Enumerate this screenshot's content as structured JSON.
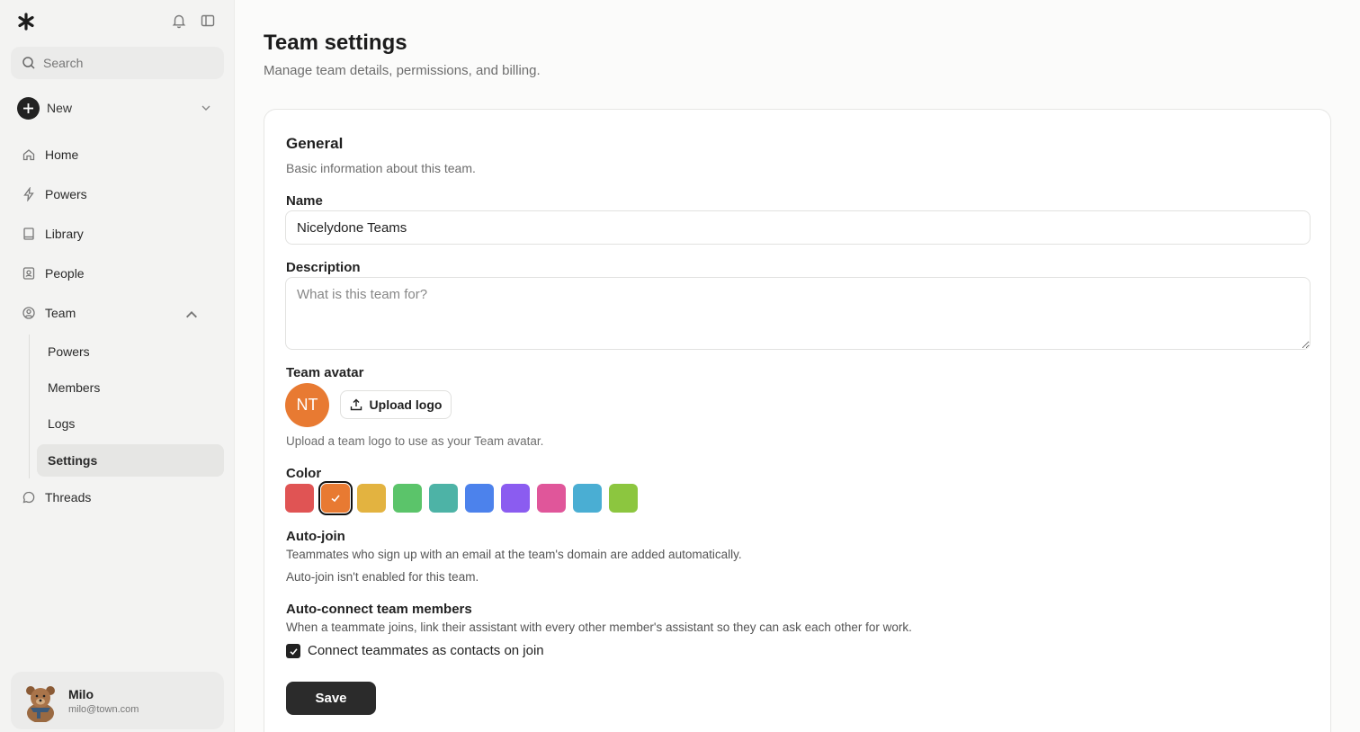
{
  "sidebar": {
    "search_placeholder": "Search",
    "new_label": "New",
    "nav": {
      "home": "Home",
      "powers": "Powers",
      "library": "Library",
      "people": "People",
      "team": "Team",
      "threads": "Threads"
    },
    "team_sub": {
      "powers": "Powers",
      "members": "Members",
      "logs": "Logs",
      "settings": "Settings"
    },
    "user": {
      "name": "Milo",
      "email": "milo@town.com"
    }
  },
  "page": {
    "title": "Team settings",
    "subtitle": "Manage team details, permissions, and billing."
  },
  "general": {
    "title": "General",
    "subtitle": "Basic information about this team.",
    "name_label": "Name",
    "name_value": "Nicelydone Teams",
    "description_label": "Description",
    "description_placeholder": "What is this team for?",
    "avatar_label": "Team avatar",
    "avatar_initials": "NT",
    "upload_label": "Upload logo",
    "upload_hint": "Upload a team logo to use as your Team avatar.",
    "color_label": "Color",
    "colors": [
      "#e05454",
      "#e87a32",
      "#e3b340",
      "#5bc46a",
      "#4db3a6",
      "#4c82ec",
      "#8b5cf0",
      "#e0569a",
      "#4aaed3",
      "#8cc63f"
    ],
    "selected_color": "#e87a32",
    "autojoin_title": "Auto-join",
    "autojoin_desc": "Teammates who sign up with an email at the team's domain are added automatically.",
    "autojoin_status": "Auto-join isn't enabled for this team.",
    "autoconnect_title": "Auto-connect team members",
    "autoconnect_desc": "When a teammate joins, link their assistant with every other member's assistant so they can ask each other for work.",
    "autoconnect_checkbox": "Connect teammates as contacts on join",
    "autoconnect_checked": true,
    "save_label": "Save"
  }
}
